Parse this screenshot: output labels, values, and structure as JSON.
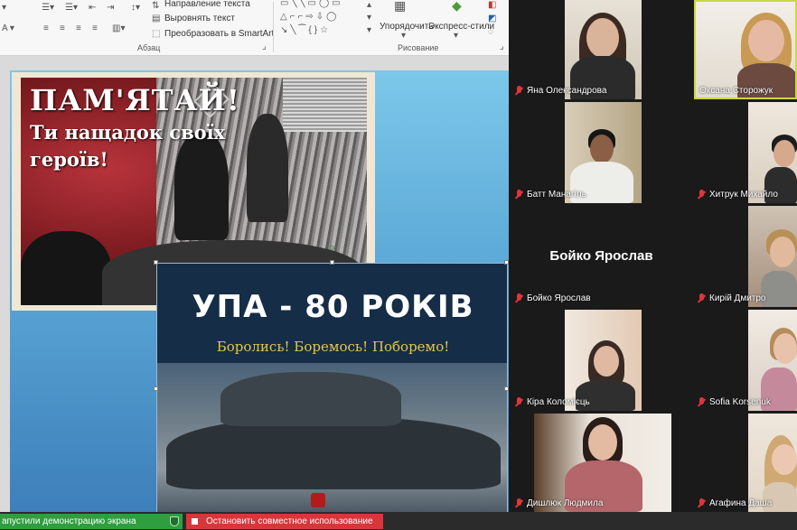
{
  "ribbon": {
    "text_direction": "Направление текста",
    "align_text": "Выровнять текст",
    "smartart": "Преобразовать в SmartArt",
    "paragraph_group": "Абзац",
    "arrange": "Упорядочить",
    "quick_styles": "Экспресс-стили",
    "drawing_group": "Рисование"
  },
  "slide": {
    "poster1": {
      "line1": "ПАМ'ЯТАЙ!",
      "line2": "Ти нащадок своїх",
      "line3": "героїв!"
    },
    "poster2": {
      "title": "УПА - 80 РОКІВ",
      "subtitle": "Боролись! Боремось! Поборемо!"
    }
  },
  "status": {
    "share_status": "апустили демонстрацию экрана",
    "stop_share": "Остановить совместное использование"
  },
  "participants": [
    {
      "name": "Яна Олександрова",
      "muted": true
    },
    {
      "name": "Оксана Сторожук",
      "muted": false,
      "active": true
    },
    {
      "name": "Батт Манагіль",
      "muted": true
    },
    {
      "name": "Хитрук Михайло",
      "muted": true
    },
    {
      "name": "Бойко Ярослав",
      "muted": true,
      "video_off": true,
      "display_name": "Бойко Ярослав"
    },
    {
      "name": "Кирій Дмитро",
      "muted": true
    },
    {
      "name": "Кіра Коломієць",
      "muted": true
    },
    {
      "name": "Sofia Korsenuk",
      "muted": true
    },
    {
      "name": "Дишлюк Людмила",
      "muted": true
    },
    {
      "name": "Агафина Даша",
      "muted": true
    }
  ],
  "colors": {
    "mic_muted": "#e0353b",
    "active_speaker": "#c9d940",
    "share_green": "#2e9e3f",
    "stop_red": "#d7373a"
  }
}
